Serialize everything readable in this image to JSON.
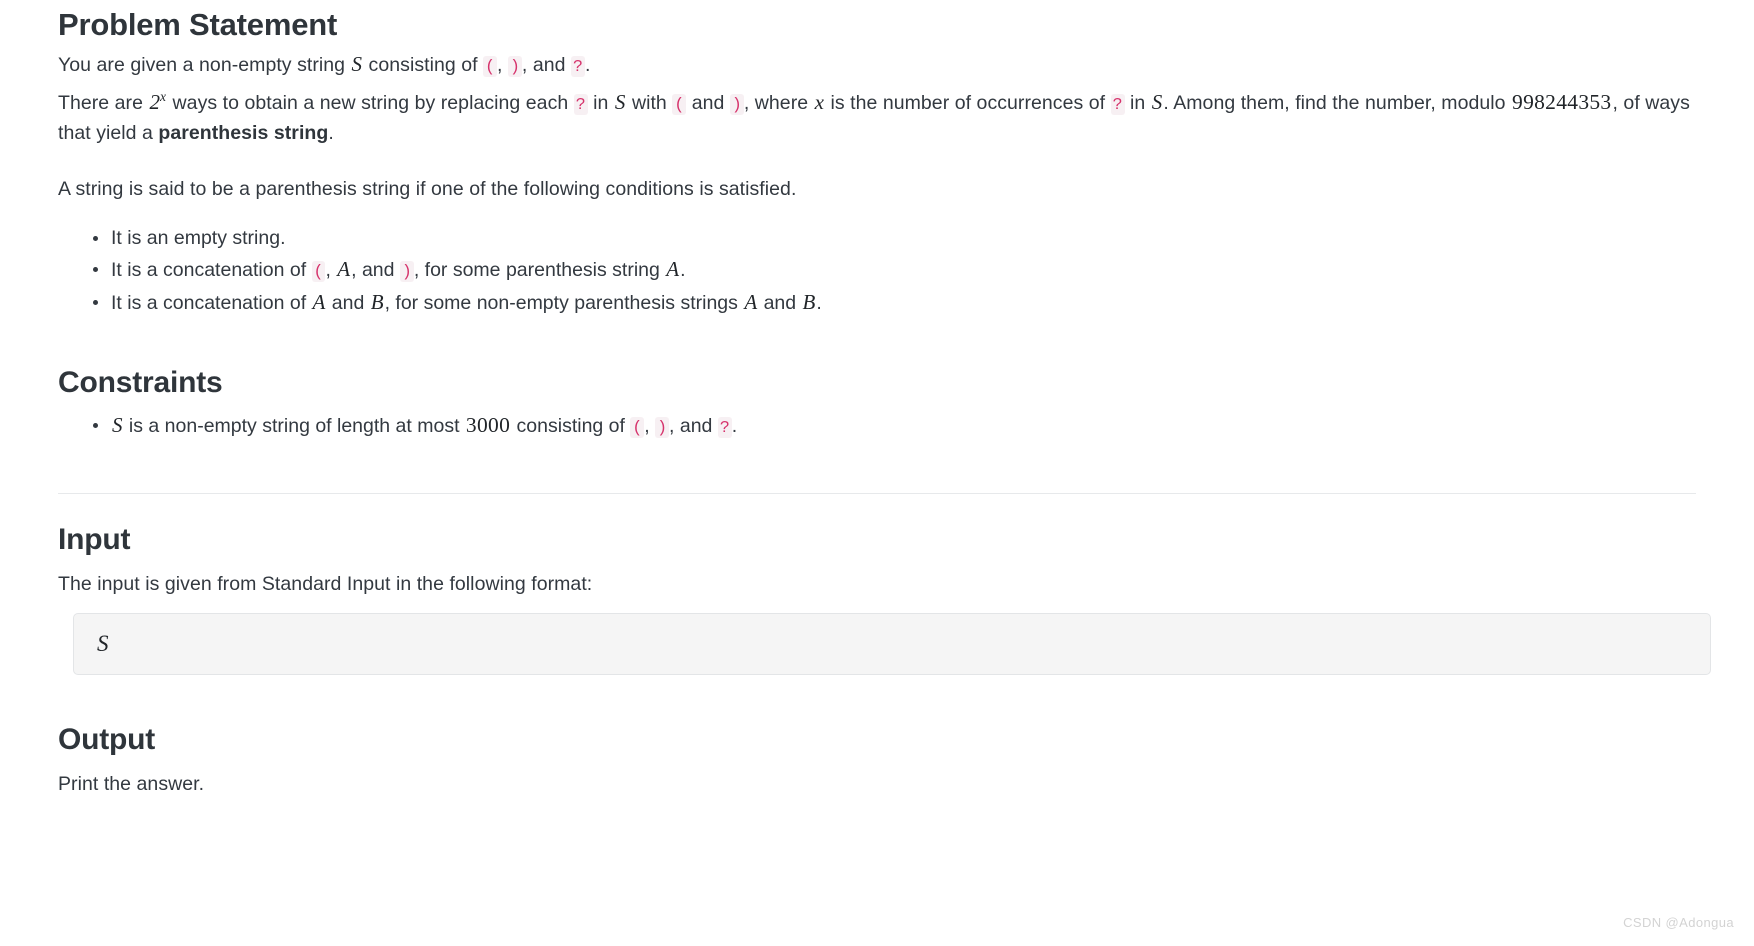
{
  "document": {
    "sections": {
      "problem_statement": {
        "heading": "Problem Statement",
        "p1": {
          "t1": "You are given a non-empty string ",
          "m1": "S",
          "t2": " consisting of ",
          "c1": "(",
          "t3": ", ",
          "c2": ")",
          "t4": ", and ",
          "c3": "?",
          "t5": "."
        },
        "p2": {
          "t1": "There are ",
          "m1_base": "2",
          "m1_exp": "x",
          "t2": " ways to obtain a new string by replacing each ",
          "c1": "?",
          "t3": " in ",
          "m2": "S",
          "t4": " with ",
          "c2": "(",
          "t5": " and ",
          "c3": ")",
          "t6": ", where ",
          "m3": "x",
          "t7": " is the number of occurrences of ",
          "c4": "?",
          "t8": " in ",
          "m4": "S",
          "t9": ". Among them, find the number, modulo ",
          "m5": "998244353",
          "t10": ", of ways that yield a ",
          "bold1": "parenthesis string",
          "t11": "."
        },
        "p3": "A string is said to be a parenthesis string if one of the following conditions is satisfied.",
        "bullets": [
          {
            "t1": "It is an empty string."
          },
          {
            "t1": "It is a concatenation of ",
            "c1": "(",
            "t2": ", ",
            "m1": "A",
            "t3": ", and ",
            "c2": ")",
            "t4": ", for some parenthesis string ",
            "m2": "A",
            "t5": "."
          },
          {
            "t1": "It is a concatenation of ",
            "m1": "A",
            "t2": " and ",
            "m2": "B",
            "t3": ", for some non-empty parenthesis strings ",
            "m3": "A",
            "t4": " and ",
            "m4": "B",
            "t5": "."
          }
        ]
      },
      "constraints": {
        "heading": "Constraints",
        "bullets": [
          {
            "m1": "S",
            "t1": " is a non-empty string of length at most ",
            "m2": "3000",
            "t2": " consisting of ",
            "c1": "(",
            "t3": ", ",
            "c2": ")",
            "t4": ", and ",
            "c3": "?",
            "t5": "."
          }
        ]
      },
      "input": {
        "heading": "Input",
        "description": "The input is given from Standard Input in the following format:",
        "format_block": "S"
      },
      "output": {
        "heading": "Output",
        "description": "Print the answer."
      }
    },
    "watermark": "CSDN @Adongua",
    "colors": {
      "code_text": "#d6336c",
      "code_bg": "#f7f0f3",
      "body_text": "#333940",
      "heading_text": "#2f353b",
      "block_bg": "#f5f5f5",
      "block_border": "#e3e5e7",
      "divider": "#e7e9eb",
      "watermark": "#d3d3d3"
    }
  }
}
